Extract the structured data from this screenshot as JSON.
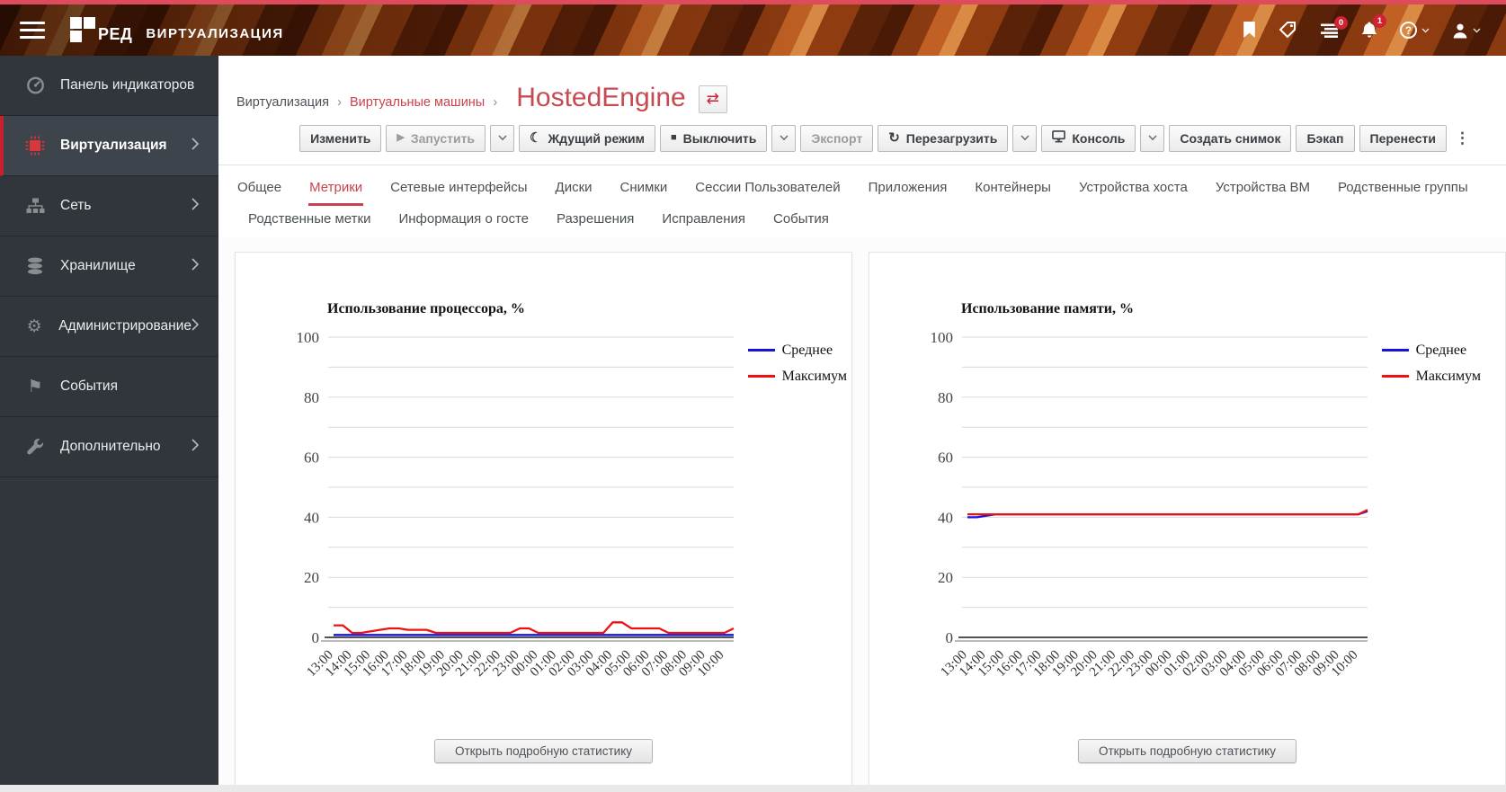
{
  "header": {
    "brand_bold": "РЕД",
    "brand_text": "ВИРТУАЛИЗАЦИЯ",
    "badges": {
      "tasks_count": "0",
      "notifications_count": "1"
    }
  },
  "sidebar": {
    "items": [
      {
        "name": "dashboard",
        "label": "Панель индикаторов",
        "icon": "gauge",
        "chevron": false,
        "active": false
      },
      {
        "name": "virtualization",
        "label": "Виртуализация",
        "icon": "chip",
        "chevron": true,
        "active": true
      },
      {
        "name": "network",
        "label": "Сеть",
        "icon": "sitemap",
        "chevron": true,
        "active": false
      },
      {
        "name": "storage",
        "label": "Хранилище",
        "icon": "database",
        "chevron": true,
        "active": false
      },
      {
        "name": "administration",
        "label": "Администрирование",
        "icon": "gear",
        "chevron": true,
        "active": false
      },
      {
        "name": "events",
        "label": "События",
        "icon": "flag",
        "chevron": false,
        "active": false
      },
      {
        "name": "additional",
        "label": "Дополнительно",
        "icon": "wrench",
        "chevron": true,
        "active": false
      }
    ]
  },
  "breadcrumb": {
    "items": [
      "Виртуализация",
      "Виртуальные машины"
    ],
    "title": "HostedEngine",
    "swap_icon": "⇄"
  },
  "toolbar": {
    "buttons": [
      {
        "name": "edit",
        "label": "Изменить"
      },
      {
        "name": "run",
        "label": "Запустить",
        "icon": "play",
        "disabled": true
      },
      {
        "name": "run-caret",
        "type": "caret"
      },
      {
        "name": "suspend",
        "label": "Ждущий режим",
        "icon": "moon"
      },
      {
        "name": "shutdown",
        "label": "Выключить",
        "icon": "stop"
      },
      {
        "name": "shutdown-caret",
        "type": "caret"
      },
      {
        "name": "export",
        "label": "Экспорт",
        "disabled": true
      },
      {
        "name": "reboot",
        "label": "Перезагрузить",
        "icon": "refresh"
      },
      {
        "name": "reboot-caret",
        "type": "caret"
      },
      {
        "name": "console",
        "label": "Консоль",
        "icon": "monitor"
      },
      {
        "name": "console-caret",
        "type": "caret"
      },
      {
        "name": "create-snapshot",
        "label": "Создать снимок"
      },
      {
        "name": "backup",
        "label": "Бэкап"
      },
      {
        "name": "migrate",
        "label": "Перенести"
      },
      {
        "name": "more-actions",
        "type": "kebab",
        "label": "⋮"
      }
    ]
  },
  "tabs": {
    "row1": [
      {
        "label": "Общее",
        "active": false
      },
      {
        "label": "Метрики",
        "active": true
      },
      {
        "label": "Сетевые интерфейсы",
        "active": false
      },
      {
        "label": "Диски",
        "active": false
      },
      {
        "label": "Снимки",
        "active": false
      },
      {
        "label": "Сессии Пользователей",
        "active": false
      },
      {
        "label": "Приложения",
        "active": false
      },
      {
        "label": "Контейнеры",
        "active": false
      },
      {
        "label": "Устройства хоста",
        "active": false
      },
      {
        "label": "Устройства ВМ",
        "active": false
      },
      {
        "label": "Родственные группы",
        "active": false
      }
    ],
    "row2": [
      {
        "label": "Родственные метки",
        "active": false
      },
      {
        "label": "Информация о госте",
        "active": false
      },
      {
        "label": "Разрешения",
        "active": false
      },
      {
        "label": "Исправления",
        "active": false
      },
      {
        "label": "События",
        "active": false
      }
    ]
  },
  "cards": {
    "detail_button_label": "Открыть подробную статистику"
  },
  "colors": {
    "accent_red": "#c9434e",
    "sidebar_active_border": "#c9202e",
    "series_avg_blue": "#1414dd",
    "series_max_red": "#ee1111"
  },
  "chart_data": [
    {
      "type": "line",
      "title": "Использование процессора, %",
      "ylim": [
        0,
        100
      ],
      "y_ticks": [
        0,
        20,
        40,
        60,
        80,
        100
      ],
      "grid_step": 10,
      "legend_position": "right",
      "x_labels": [
        "13:00",
        "14:00",
        "15:00",
        "16:00",
        "17:00",
        "18:00",
        "19:00",
        "20:00",
        "21:00",
        "22:00",
        "23:00",
        "00:00",
        "01:00",
        "02:00",
        "03:00",
        "04:00",
        "05:00",
        "06:00",
        "07:00",
        "08:00",
        "09:00",
        "10:00"
      ],
      "series": [
        {
          "name": "Среднее",
          "color": "#1414dd",
          "values": [
            0.8,
            0.8,
            0.8,
            0.8,
            0.8,
            0.8,
            0.8,
            0.8,
            0.8,
            0.8,
            0.8,
            0.8,
            0.8,
            0.8,
            0.8,
            0.8,
            0.8,
            0.8,
            0.8,
            0.8,
            0.8,
            0.8,
            0.8,
            0.8,
            0.8,
            0.8,
            0.8,
            0.8,
            0.8,
            0.8,
            0.8,
            0.8,
            0.8,
            0.8,
            0.8,
            0.8,
            0.8,
            0.8,
            0.8,
            0.8,
            0.8,
            0.8,
            0.8,
            0.8
          ]
        },
        {
          "name": "Максимум",
          "color": "#ee1111",
          "values": [
            4,
            4,
            1.5,
            1.5,
            2,
            2.5,
            3,
            3,
            2.5,
            2.5,
            2.5,
            1.5,
            1.5,
            1.5,
            1.5,
            1.5,
            1.5,
            1.5,
            1.5,
            1.5,
            3,
            3,
            1.5,
            1.5,
            1.5,
            1.5,
            1.5,
            1.5,
            1.5,
            1.5,
            5,
            5,
            3,
            3,
            3,
            3,
            1.5,
            1.5,
            1.5,
            1.5,
            1.5,
            1.5,
            1.5,
            3
          ]
        }
      ]
    },
    {
      "type": "line",
      "title": "Использование памяти, %",
      "ylim": [
        0,
        100
      ],
      "y_ticks": [
        0,
        20,
        40,
        60,
        80,
        100
      ],
      "grid_step": 10,
      "legend_position": "right",
      "x_labels": [
        "13:00",
        "14:00",
        "15:00",
        "16:00",
        "17:00",
        "18:00",
        "19:00",
        "20:00",
        "21:00",
        "22:00",
        "23:00",
        "00:00",
        "01:00",
        "02:00",
        "03:00",
        "04:00",
        "05:00",
        "06:00",
        "07:00",
        "08:00",
        "09:00",
        "10:00"
      ],
      "series": [
        {
          "name": "Среднее",
          "color": "#1414dd",
          "values": [
            40,
            40,
            40.5,
            41,
            41,
            41,
            41,
            41,
            41,
            41,
            41,
            41,
            41,
            41,
            41,
            41,
            41,
            41,
            41,
            41,
            41,
            41,
            41,
            41,
            41,
            41,
            41,
            41,
            41,
            41,
            41,
            41,
            41,
            41,
            41,
            41,
            41,
            41,
            41,
            41,
            41,
            41,
            41,
            42
          ]
        },
        {
          "name": "Максимум",
          "color": "#ee1111",
          "values": [
            41,
            41,
            41,
            41,
            41,
            41,
            41,
            41,
            41,
            41,
            41,
            41,
            41,
            41,
            41,
            41,
            41,
            41,
            41,
            41,
            41,
            41,
            41,
            41,
            41,
            41,
            41,
            41,
            41,
            41,
            41,
            41,
            41,
            41,
            41,
            41,
            41,
            41,
            41,
            41,
            41,
            41,
            41,
            42.5
          ]
        }
      ]
    }
  ]
}
